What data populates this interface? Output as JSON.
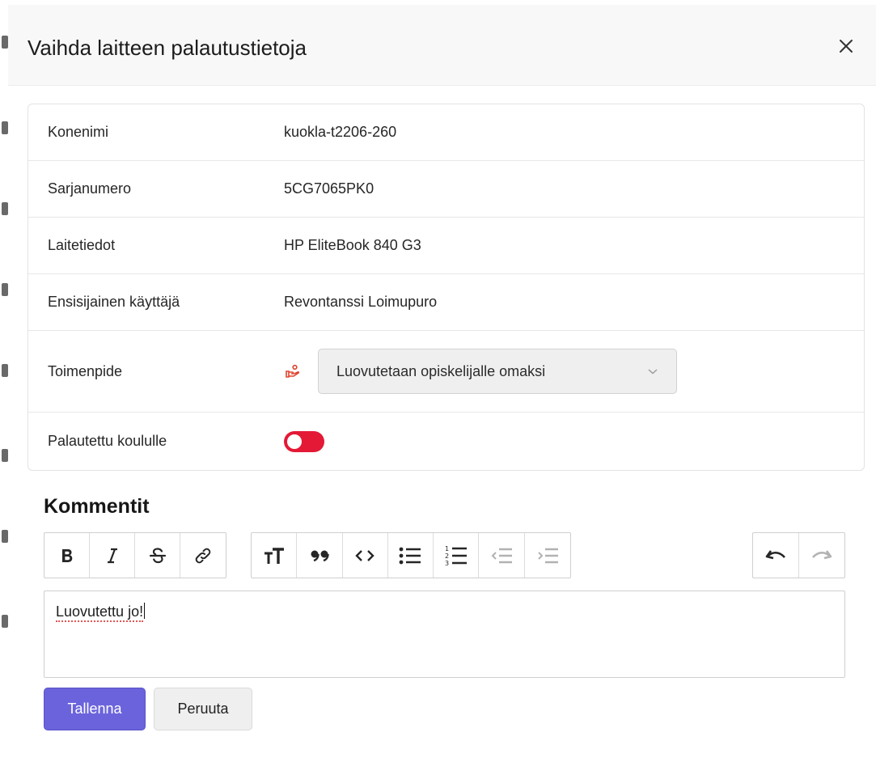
{
  "dialog": {
    "title": "Vaihda laitteen palautustietoja"
  },
  "details": {
    "computer_name": {
      "label": "Konenimi",
      "value": "kuokla-t2206-260"
    },
    "serial_number": {
      "label": "Sarjanumero",
      "value": "5CG7065PK0"
    },
    "device_info": {
      "label": "Laitetiedot",
      "value": "HP EliteBook 840 G3"
    },
    "primary_user": {
      "label": "Ensisijainen käyttäjä",
      "value": "Revontanssi Loimupuro"
    },
    "action": {
      "label": "Toimenpide",
      "icon": "hand-give-icon",
      "icon_color": "#e0432f",
      "selected": "Luovutetaan opiskelijalle omaksi"
    },
    "returned": {
      "label": "Palautettu koululle",
      "on": false,
      "color": "#e31936"
    }
  },
  "comments": {
    "title": "Kommentit",
    "toolbar": [
      "bold-icon",
      "italic-icon",
      "strikethrough-icon",
      "link-icon",
      "heading-icon",
      "quote-icon",
      "code-icon",
      "bullet-list-icon",
      "numbered-list-icon",
      "outdent-icon",
      "indent-icon",
      "undo-icon",
      "redo-icon"
    ],
    "text": "Luovutettu jo!"
  },
  "buttons": {
    "save": "Tallenna",
    "cancel": "Peruuta"
  },
  "colors": {
    "primary": "#6b63dc",
    "toggle_off": "#e31936"
  }
}
